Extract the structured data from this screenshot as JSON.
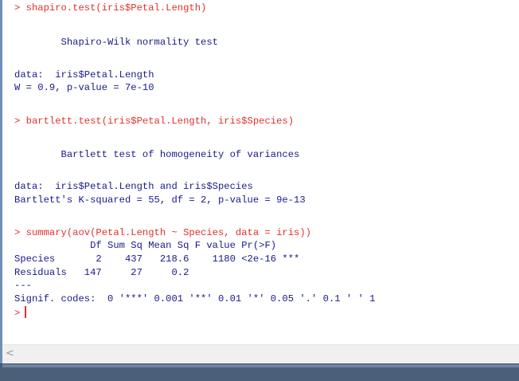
{
  "console": {
    "lines": [
      {
        "type": "cmd",
        "text": "> shapiro.test(iris$Petal.Length)"
      },
      {
        "type": "out",
        "text": "        Shapiro-Wilk normality test"
      },
      {
        "type": "out",
        "text": "data:  iris$Petal.Length"
      },
      {
        "type": "out",
        "text": "W = 0.9, p-value = 7e-10"
      },
      {
        "type": "cmd",
        "text": "> bartlett.test(iris$Petal.Length, iris$Species)"
      },
      {
        "type": "out",
        "text": "        Bartlett test of homogeneity of variances"
      },
      {
        "type": "out",
        "text": "data:  iris$Petal.Length and iris$Species"
      },
      {
        "type": "out",
        "text": "Bartlett's K-squared = 55, df = 2, p-value = 9e-13"
      },
      {
        "type": "cmd",
        "text": "> summary(aov(Petal.Length ~ Species, data = iris))"
      },
      {
        "type": "out",
        "text": "             Df Sum Sq Mean Sq F value Pr(>F)    "
      },
      {
        "type": "out",
        "text": "Species       2    437   218.6    1180 <2e-16 ***"
      },
      {
        "type": "out",
        "text": "Residuals   147     27     0.2                   "
      },
      {
        "type": "out",
        "text": "---"
      },
      {
        "type": "out",
        "text": "Signif. codes:  0 '***' 0.001 '**' 0.01 '*' 0.05 '.' 0.1 ' ' 1"
      },
      {
        "type": "cmd",
        "text": ">"
      }
    ]
  },
  "scrollbar": {
    "left_arrow": "<"
  },
  "colors": {
    "command": "#e0312b",
    "output": "#1a1a8c",
    "status_bar": "#4c5f78"
  }
}
